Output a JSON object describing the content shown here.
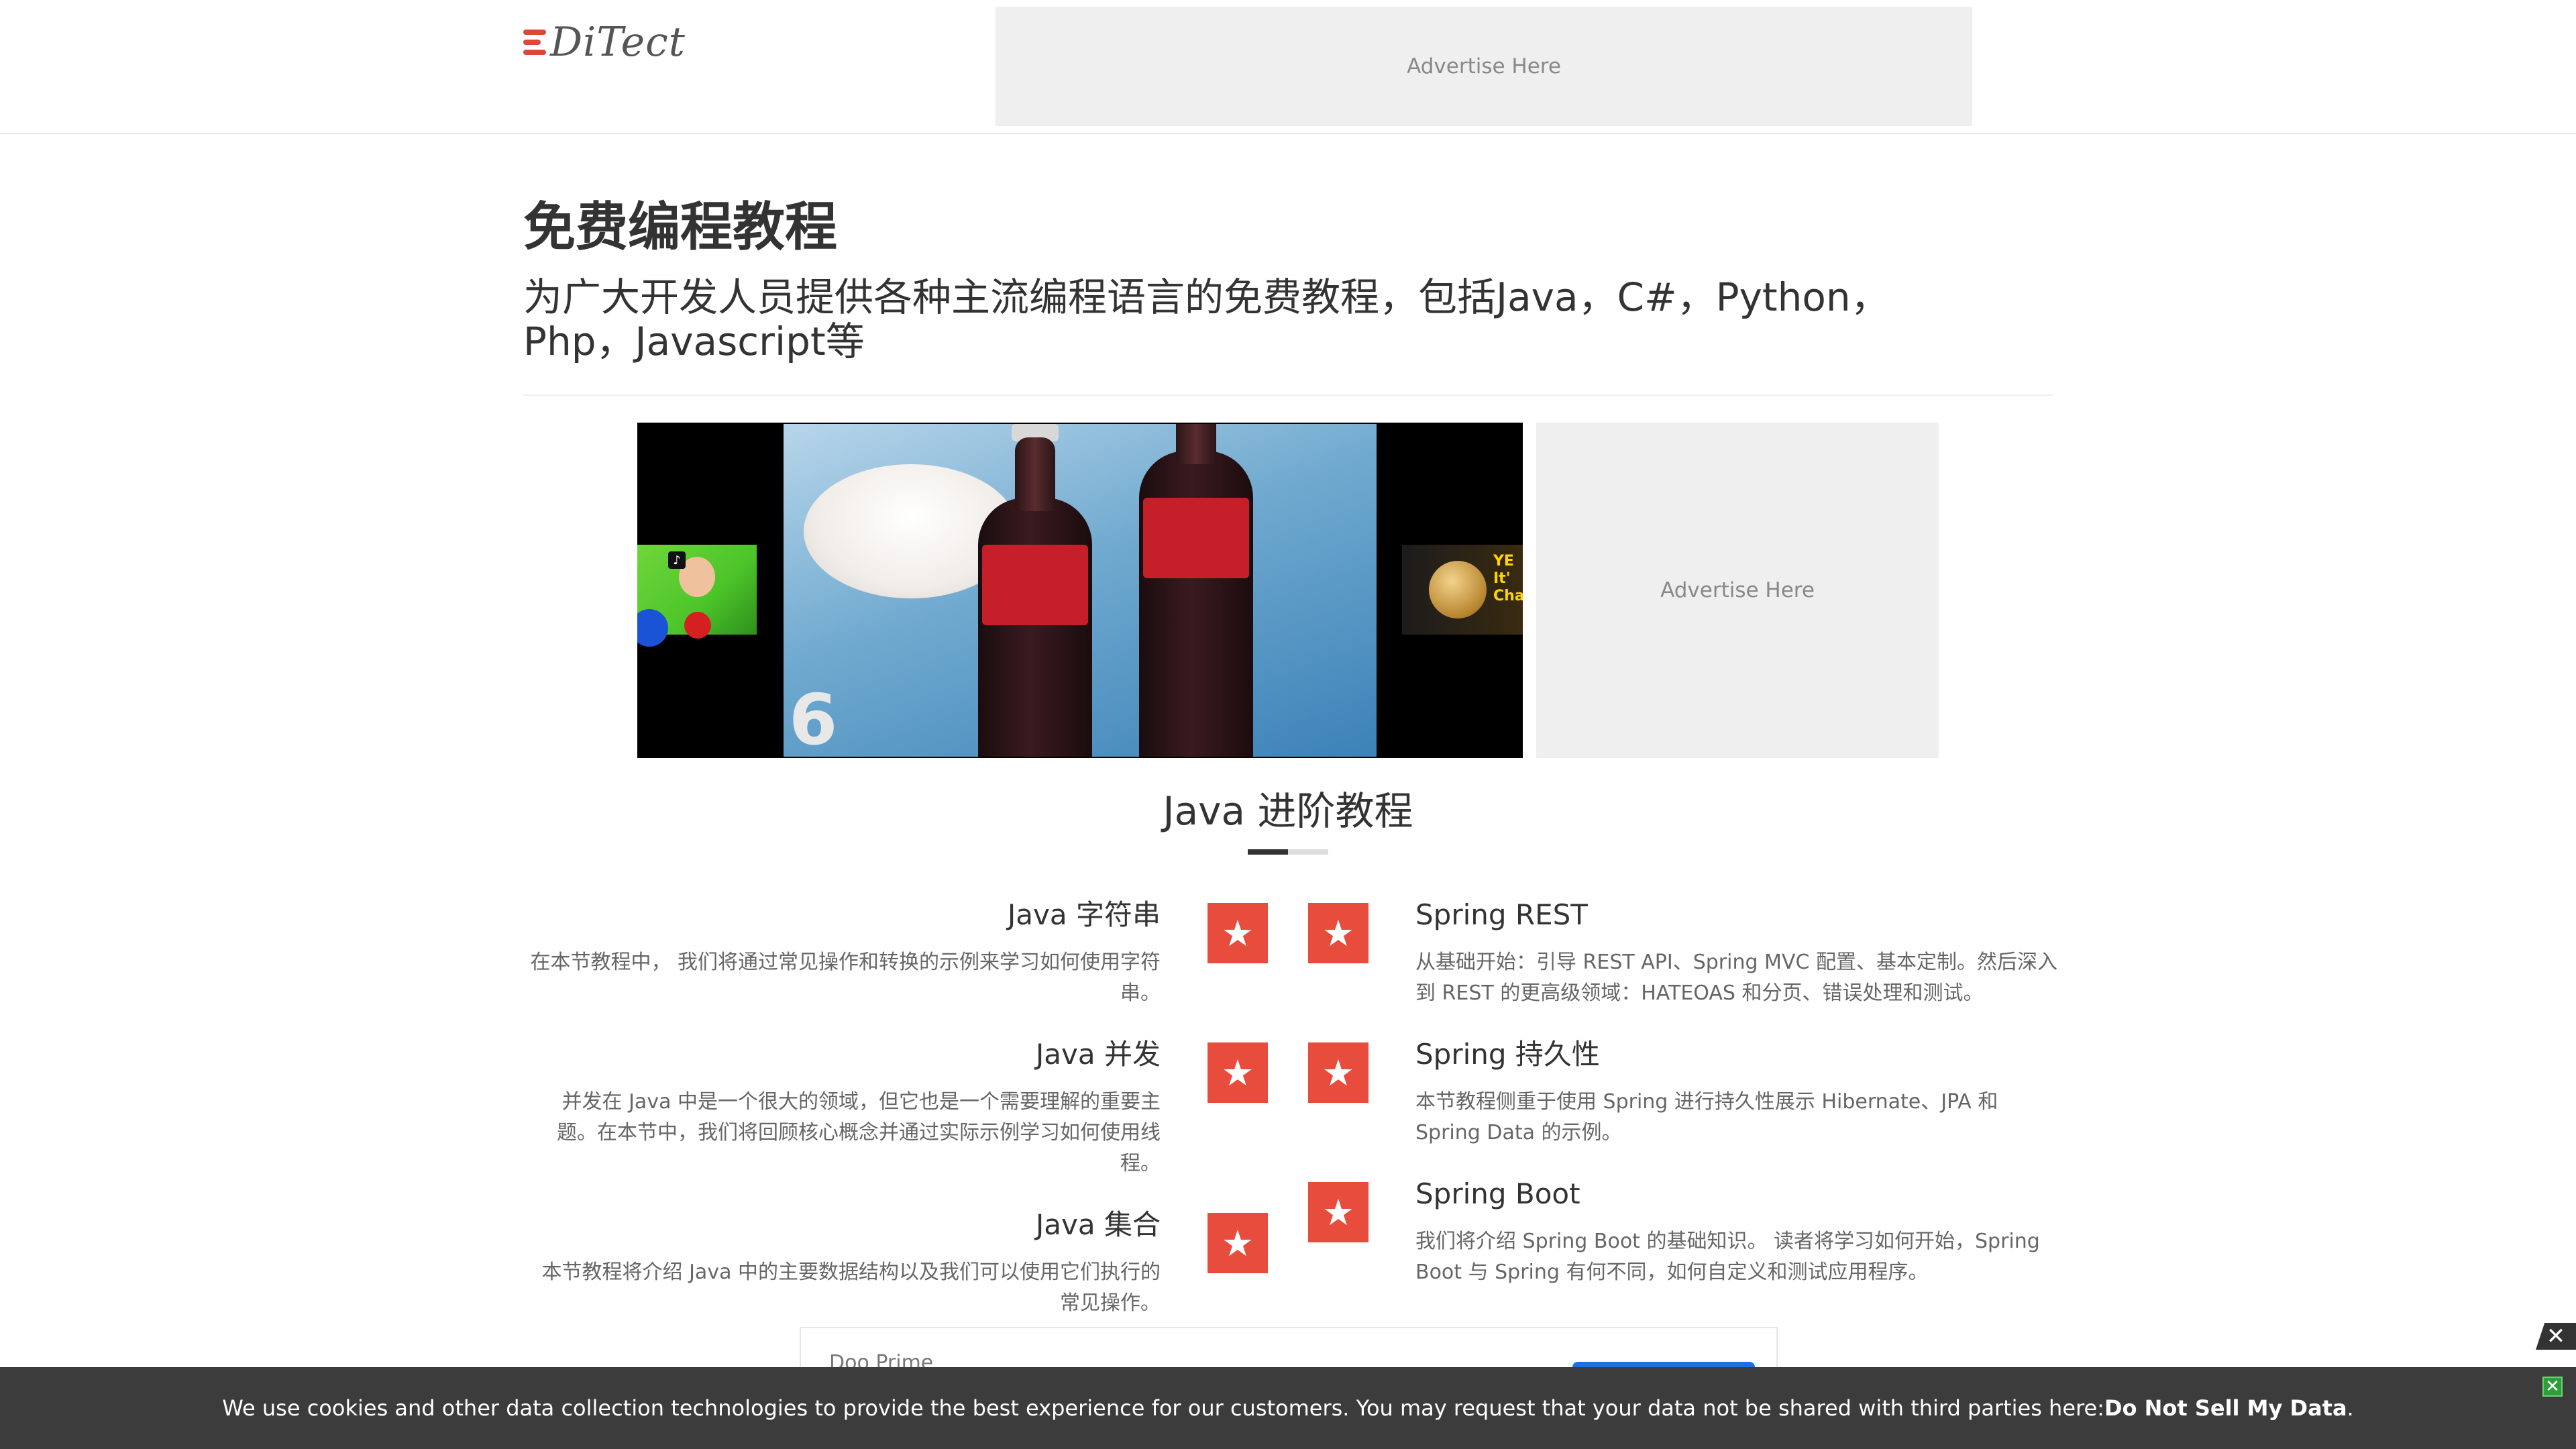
{
  "header": {
    "logo_text": "DiTect",
    "ad_label": "Advertise Here"
  },
  "hero": {
    "title": "免费编程教程",
    "subtitle": "为广大开发人员提供各种主流编程语言的免费教程，包括Java，C#，Python，Php，Javascript等"
  },
  "media": {
    "frame_number": "6",
    "thumb_left_badge": "♪",
    "thumb_right_text": "YE It' Cha",
    "side_ad_label": "Advertise Here"
  },
  "section": {
    "title": "Java 进阶教程",
    "left_items": [
      {
        "title": "Java 字符串",
        "desc": "在本节教程中， 我们将通过常见操作和转换的示例来学习如何使用字符串。"
      },
      {
        "title": "Java 并发",
        "desc": "并发在 Java 中是一个很大的领域，但它也是一个需要理解的重要主题。在本节中，我们将回顾核心概念并通过实际示例学习如何使用线程。"
      },
      {
        "title": "Java 集合",
        "desc": "本节教程将介绍 Java 中的主要数据结构以及我们可以使用它们执行的常见操作。"
      }
    ],
    "right_items": [
      {
        "title": "Spring REST",
        "desc": "从基础开始：引导 REST API、Spring MVC 配置、基本定制。然后深入到 REST 的更高级领域：HATEOAS 和分页、错误处理和测试。"
      },
      {
        "title": "Spring 持久性",
        "desc": "本节教程侧重于使用 Spring 进行持久性展示 Hibernate、JPA 和 Spring Data 的示例。"
      },
      {
        "title": "Spring Boot",
        "desc": "我们将介绍 Spring Boot 的基础知识。 读者将学习如何开始，Spring Boot 与 Spring 有何不同，如何自定义和测试应用程序。"
      }
    ],
    "star_icon": "★"
  },
  "popup": {
    "brand": "Doo Prime",
    "close_glyph": "✕"
  },
  "cookie": {
    "message": "We use cookies and other data collection technologies to provide the best experience for our customers. You may request that your data not be shared with third parties here: ",
    "link_text": "Do Not Sell My Data",
    "trailing": ".",
    "close_glyph": "✕"
  },
  "colors": {
    "accent": "#e74c3c",
    "cookie_bar": "#3c3c3c",
    "ad_bg": "#efefef"
  }
}
